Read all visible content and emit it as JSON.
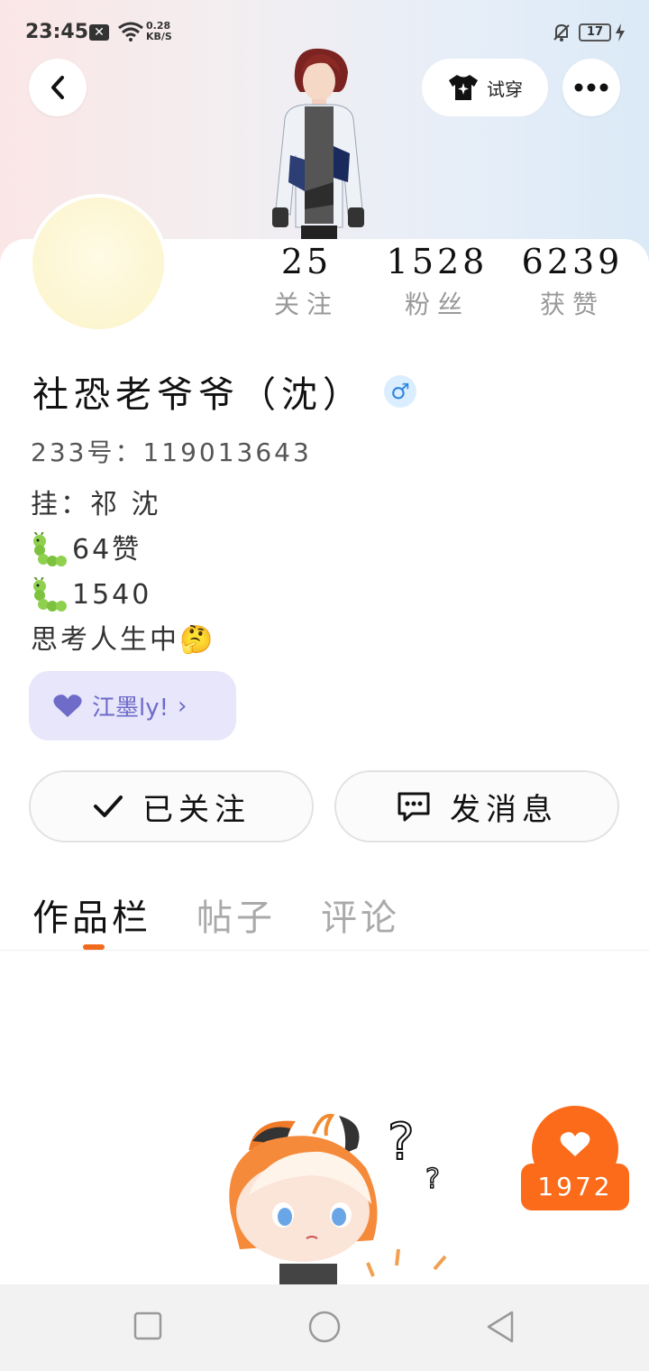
{
  "status_bar": {
    "time": "23:45",
    "speed_value": "0.28",
    "speed_unit": "KB/S",
    "battery": "17",
    "icons": [
      "close-box-icon",
      "wifi-icon",
      "bell-off-icon",
      "battery-icon",
      "charging-icon"
    ]
  },
  "header": {
    "try_on_label": "试穿",
    "icons": [
      "back-icon",
      "tshirt-sparkle-icon",
      "more-icon"
    ]
  },
  "profile": {
    "stats": [
      {
        "value": "25",
        "label": "关注"
      },
      {
        "value": "1528",
        "label": "粉丝"
      },
      {
        "value": "6239",
        "label": "获赞"
      }
    ],
    "name": "社恐老爷爷（沈）",
    "gender_symbol": "♂",
    "uid": "233号：119013643",
    "bio": {
      "line1": "挂：祁  沈",
      "line2": "64赞",
      "line3": "1540",
      "line4": "思考人生中",
      "emoji_thinking": "🤔"
    },
    "fan_badge": {
      "label": "江墨ly!",
      "chevron": "›"
    }
  },
  "actions": {
    "follow_label": "已关注",
    "message_label": "发消息"
  },
  "tabs": [
    {
      "label": "作品栏",
      "active": true
    },
    {
      "label": "帖子",
      "active": false
    },
    {
      "label": "评论",
      "active": false
    }
  ],
  "floating_like": {
    "count": "1972"
  },
  "colors": {
    "accent": "#fb6b1a",
    "badge_bg": "#e7e6fb",
    "badge_text": "#6e6bc9",
    "gender_blue": "#2f86e0"
  }
}
